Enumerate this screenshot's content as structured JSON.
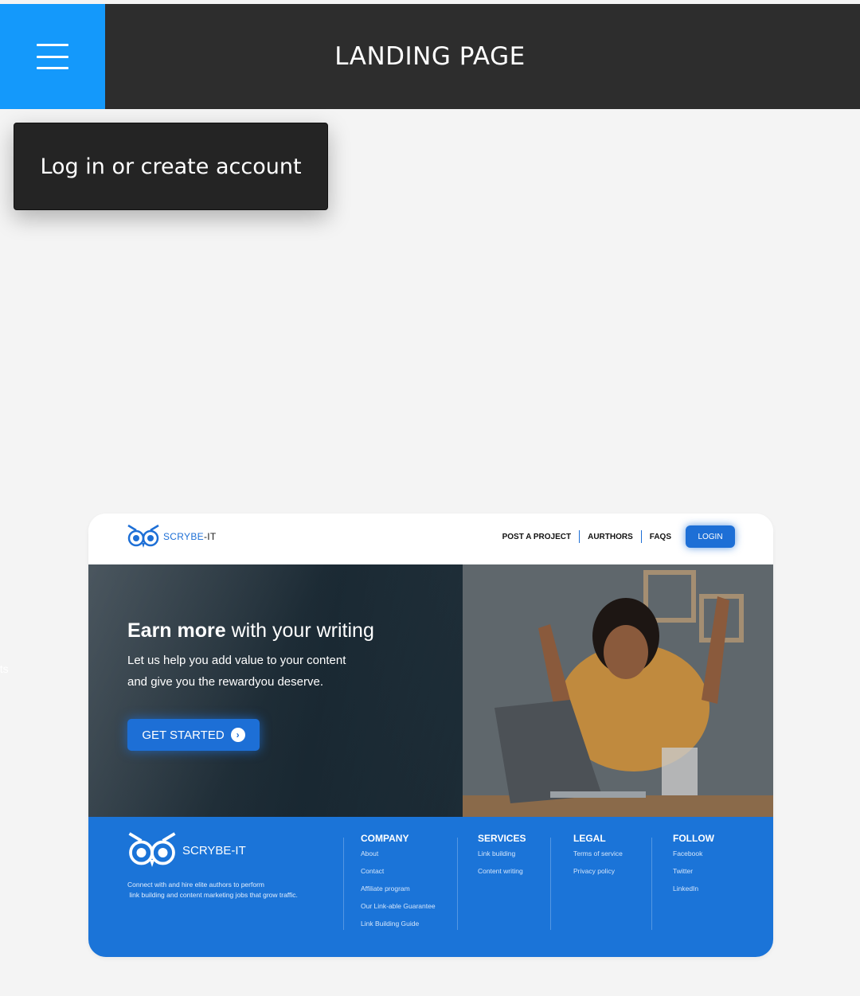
{
  "appbar": {
    "title": "LANDING PAGE",
    "menu_icon": "hamburger-menu-icon",
    "colors": {
      "bar": "#2d2d2d",
      "menu_button": "#1499fb"
    }
  },
  "popup": {
    "label": "Log in or create account"
  },
  "mockup": {
    "brand": {
      "name_prefix": "SCRYBE",
      "name_suffix": "-IT",
      "logo_icon": "owl-logo-icon"
    },
    "nav": {
      "post_project": "POST A PROJECT",
      "authors": "AURTHORS",
      "faqs": "FAQS",
      "login": "LOGIN"
    },
    "hero": {
      "title_bold": "Earn more",
      "title_rest": " with your writing",
      "subtitle_line1": "Let us help you add value to your content",
      "subtitle_line2": "and give you the rewardyou deserve.",
      "cta": "GET STARTED",
      "cta_icon": "chevron-right-circle-icon"
    },
    "footer": {
      "brand": "SCRYBE-IT",
      "description_line1": "Connect with and hire elite authors to perform",
      "description_line2": " link building and content marketing jobs that grow traffic.",
      "columns": [
        {
          "heading": "COMPANY",
          "items": [
            "About",
            "Contact",
            "Affiliate program",
            "Our Link-able Guarantee",
            "Link Building Guide"
          ]
        },
        {
          "heading": "SERVICES",
          "items": [
            "Link building",
            "Content writing"
          ]
        },
        {
          "heading": "LEGAL",
          "items": [
            "Terms of service",
            "Privacy policy"
          ]
        },
        {
          "heading": "FOLLOW",
          "items": [
            "Facebook",
            "Twitter",
            "LinkedIn"
          ]
        }
      ]
    },
    "colors": {
      "primary": "#1d6fd6",
      "footer": "#1b74d8"
    }
  },
  "edge_text": "nts"
}
